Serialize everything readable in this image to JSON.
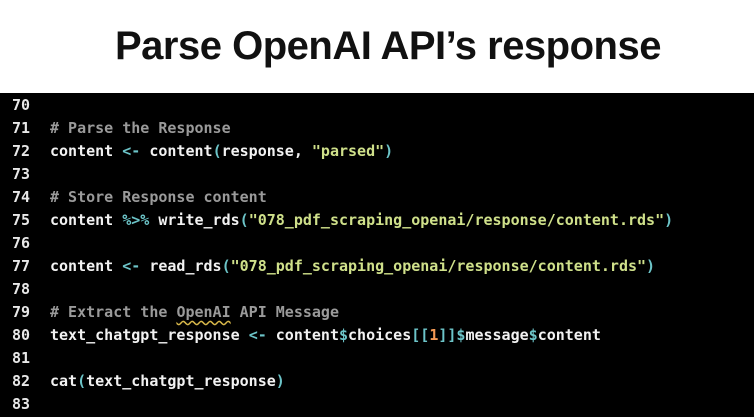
{
  "title": "Parse OpenAI API’s response",
  "colors": {
    "background": "#000000",
    "default": "#f2f2f2",
    "comment": "#9a9a9a",
    "operator": "#6cc4c8",
    "string": "#cfe08a",
    "number": "#f49a55"
  },
  "lines": [
    {
      "num": "70",
      "tokens": []
    },
    {
      "num": "71",
      "tokens": [
        {
          "t": "# Parse the Response",
          "k": "comment"
        }
      ]
    },
    {
      "num": "72",
      "tokens": [
        {
          "t": "content ",
          "k": "default"
        },
        {
          "t": "<-",
          "k": "op"
        },
        {
          "t": " content",
          "k": "default"
        },
        {
          "t": "(",
          "k": "op"
        },
        {
          "t": "response, ",
          "k": "default"
        },
        {
          "t": "\"parsed\"",
          "k": "str"
        },
        {
          "t": ")",
          "k": "op"
        }
      ]
    },
    {
      "num": "73",
      "tokens": []
    },
    {
      "num": "74",
      "tokens": [
        {
          "t": "# Store Response content",
          "k": "comment"
        }
      ]
    },
    {
      "num": "75",
      "tokens": [
        {
          "t": "content ",
          "k": "default"
        },
        {
          "t": "%>%",
          "k": "op"
        },
        {
          "t": " write_rds",
          "k": "default"
        },
        {
          "t": "(",
          "k": "op"
        },
        {
          "t": "\"078_pdf_scraping_openai/response/content.rds\"",
          "k": "str"
        },
        {
          "t": ")",
          "k": "op"
        }
      ]
    },
    {
      "num": "76",
      "tokens": []
    },
    {
      "num": "77",
      "tokens": [
        {
          "t": "content ",
          "k": "default"
        },
        {
          "t": "<-",
          "k": "op"
        },
        {
          "t": " read_rds",
          "k": "default"
        },
        {
          "t": "(",
          "k": "op"
        },
        {
          "t": "\"078_pdf_scraping_openai/response/content.rds\"",
          "k": "str"
        },
        {
          "t": ")",
          "k": "op"
        }
      ]
    },
    {
      "num": "78",
      "tokens": []
    },
    {
      "num": "79",
      "tokens": [
        {
          "t": "# Extract the ",
          "k": "comment"
        },
        {
          "t": "OpenAI",
          "k": "comment squiggle"
        },
        {
          "t": " API Message",
          "k": "comment"
        }
      ]
    },
    {
      "num": "80",
      "tokens": [
        {
          "t": "text_chatgpt_response ",
          "k": "default"
        },
        {
          "t": "<-",
          "k": "op"
        },
        {
          "t": " content",
          "k": "default"
        },
        {
          "t": "$",
          "k": "op"
        },
        {
          "t": "choices",
          "k": "default"
        },
        {
          "t": "[[",
          "k": "op"
        },
        {
          "t": "1",
          "k": "num"
        },
        {
          "t": "]]",
          "k": "op"
        },
        {
          "t": "$",
          "k": "op"
        },
        {
          "t": "message",
          "k": "default"
        },
        {
          "t": "$",
          "k": "op"
        },
        {
          "t": "content",
          "k": "default"
        }
      ]
    },
    {
      "num": "81",
      "tokens": []
    },
    {
      "num": "82",
      "tokens": [
        {
          "t": "cat",
          "k": "default"
        },
        {
          "t": "(",
          "k": "op"
        },
        {
          "t": "text_chatgpt_response",
          "k": "default"
        },
        {
          "t": ")",
          "k": "op"
        }
      ]
    },
    {
      "num": "83",
      "tokens": []
    }
  ]
}
